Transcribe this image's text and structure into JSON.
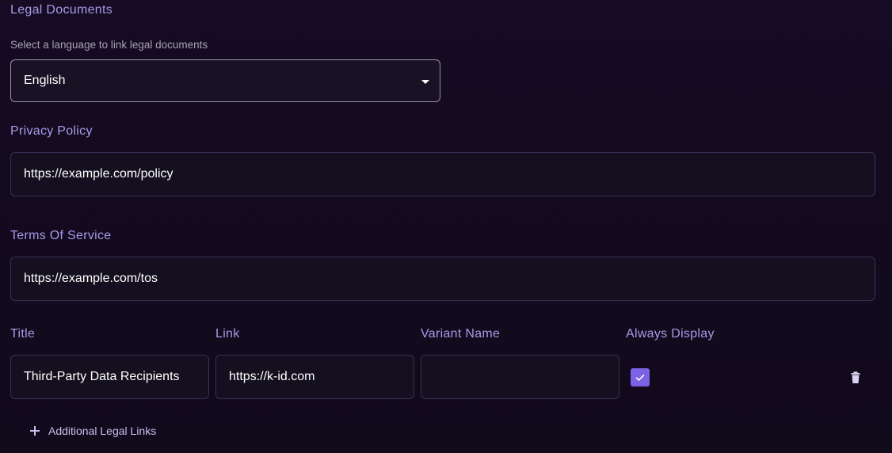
{
  "legal_documents": {
    "title": "Legal Documents",
    "helper_text": "Select a language to link legal documents",
    "language_select": {
      "value": "English"
    }
  },
  "privacy_policy": {
    "label": "Privacy Policy",
    "value": "https://example.com/policy"
  },
  "terms_of_service": {
    "label": "Terms Of Service",
    "value": "https://example.com/tos"
  },
  "legal_links": {
    "columns": {
      "title": "Title",
      "link": "Link",
      "variant_name": "Variant Name",
      "always_display": "Always Display"
    },
    "rows": [
      {
        "title": "Third-Party Data Recipients",
        "link": "https://k-id.com",
        "variant_name": "",
        "always_display": true
      }
    ],
    "add_button": "Additional Legal Links"
  },
  "icons": {
    "select_caret": "caret-down-icon",
    "checkbox_mark": "check-icon",
    "delete": "trash-icon",
    "add": "plus-icon"
  },
  "colors": {
    "accent": "#7c63e6",
    "label": "#a89ae8",
    "background": "#130b1f"
  }
}
